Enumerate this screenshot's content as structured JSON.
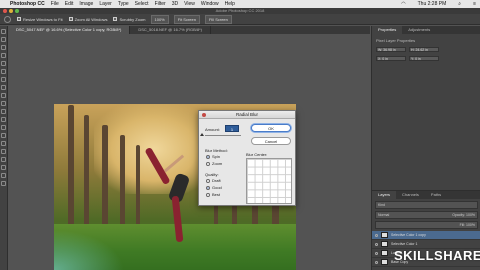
{
  "menubar": {
    "app": "Photoshop CC",
    "items": [
      "File",
      "Edit",
      "Image",
      "Layer",
      "Type",
      "Select",
      "Filter",
      "3D",
      "View",
      "Window",
      "Help"
    ],
    "clock": "Thu 2:28 PM"
  },
  "window": {
    "title": "Adobe Photoshop CC 2018"
  },
  "options_bar": {
    "resize_windows": "Resize Windows to Fit",
    "zoom_all_windows": "Zoom All Windows",
    "scrubby_zoom": "Scrubby Zoom",
    "zoom_value": "100%",
    "fit_screen": "Fit Screen",
    "fill_screen": "Fill Screen"
  },
  "doc_tabs": [
    {
      "label": "DSC_5047.NEF @ 16.6% (Selective Color 1 copy, RGB/8*)",
      "active": true
    },
    {
      "label": "DSC_5018.NEF @ 16.7% (RGB/8*)",
      "active": false
    }
  ],
  "dialog": {
    "title": "Radial Blur",
    "amount_label": "Amount:",
    "amount_value": "1",
    "ok": "OK",
    "cancel": "Cancel",
    "blur_method_label": "Blur Method:",
    "blur_methods": [
      "Spin",
      "Zoom"
    ],
    "blur_method_selected": "Spin",
    "quality_label": "Quality:",
    "qualities": [
      "Draft",
      "Good",
      "Best"
    ],
    "quality_selected": "Good",
    "blur_center_label": "Blur Center:"
  },
  "properties_panel": {
    "tabs": [
      "Properties",
      "Adjustments"
    ],
    "section": "Pixel Layer Properties",
    "w_value": "W: 36.98 in",
    "h_value": "H: 24.62 in",
    "x_value": "X: 0 in",
    "y_value": "Y: 0 in"
  },
  "layers_panel": {
    "tabs": [
      "Layers",
      "Channels",
      "Paths"
    ],
    "kind": "Kind",
    "blend_mode": "Normal",
    "opacity": "Opacity: 100%",
    "fill": "Fill: 100%",
    "layers": [
      {
        "name": "Selective Color 1 copy",
        "selected": true
      },
      {
        "name": "Selective Color 1",
        "selected": false
      },
      {
        "name": "Layer 1",
        "selected": false
      },
      {
        "name": "Base Copy",
        "selected": false
      }
    ]
  },
  "watermark": "SKILLSHARE"
}
